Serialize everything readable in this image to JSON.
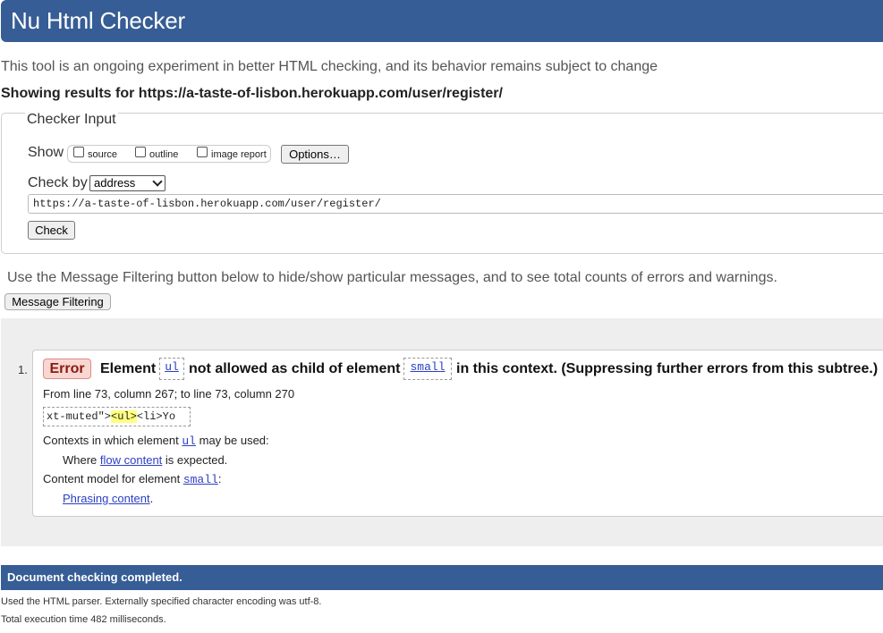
{
  "header": {
    "title": "Nu Html Checker"
  },
  "intro": "This tool is an ongoing experiment in better HTML checking, and its behavior remains subject to change",
  "showing": "Showing results for https://a-taste-of-lisbon.herokuapp.com/user/register/",
  "checker_input": {
    "legend": "Checker Input",
    "show_label": "Show",
    "checkboxes": [
      {
        "label": "source",
        "checked": false
      },
      {
        "label": "outline",
        "checked": false
      },
      {
        "label": "image report",
        "checked": false
      }
    ],
    "options_button": "Options…",
    "check_by_label": "Check by",
    "check_by_value": "address",
    "url_value": "https://a-taste-of-lisbon.herokuapp.com/user/register/",
    "check_button": "Check"
  },
  "filter_hint": "Use the Message Filtering button below to hide/show particular messages, and to see total counts of errors and warnings.",
  "filter_button": "Message Filtering",
  "messages": [
    {
      "number": "1.",
      "type": "Error",
      "text_1": "Element",
      "code_1": "ul",
      "text_2": "not allowed as child of element",
      "code_2": "small",
      "text_3": "in this context. (Suppressing further errors from this subtree.)",
      "location": "From line 73, column 267; to line 73, column 270",
      "extract_before": "xt-muted\">",
      "extract_highlight": "<ul>",
      "extract_after": "<li>Yo",
      "contexts_prefix": "Contexts in which element",
      "contexts_code": "ul",
      "contexts_suffix": "may be used:",
      "where_prefix": "Where",
      "where_link": "flow content",
      "where_suffix": "is expected.",
      "model_prefix": "Content model for element",
      "model_code": "small",
      "model_suffix": ":",
      "model_link": "Phrasing content",
      "model_end": "."
    }
  ],
  "completed": "Document checking completed.",
  "footer": {
    "parser": "Used the HTML parser. Externally specified character encoding was utf-8.",
    "time": "Total execution time 482 milliseconds."
  }
}
